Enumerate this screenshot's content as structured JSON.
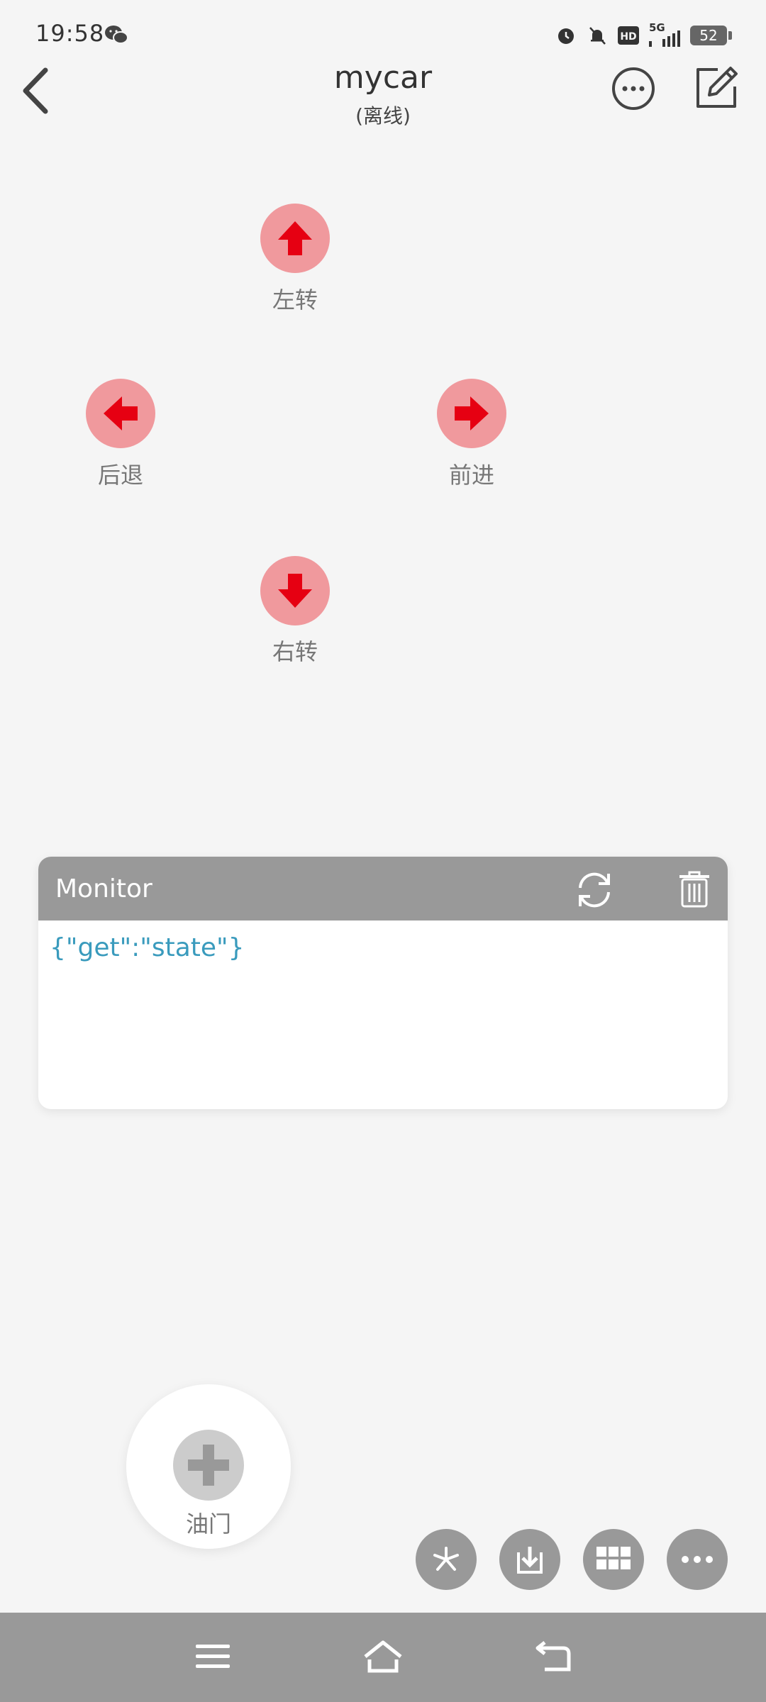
{
  "status_bar": {
    "time": "19:58",
    "network": "5G",
    "battery": "52",
    "icons": [
      "wechat-icon",
      "alarm-icon",
      "mute-bell-icon",
      "hd-icon",
      "signal-icon",
      "battery-icon"
    ]
  },
  "header": {
    "title": "mycar",
    "subtitle": "(离线)"
  },
  "controls": {
    "up_label": "左转",
    "left_label": "后退",
    "right_label": "前进",
    "down_label": "右转"
  },
  "monitor": {
    "title": "Monitor",
    "log": "{\"get\":\"state\"}"
  },
  "throttle": {
    "label": "油门"
  },
  "colors": {
    "background": "#f5f5f5",
    "button_fill": "#f0999d",
    "arrow_red": "#e60012",
    "monitor_header": "#999999",
    "monitor_text": "#3a9bbd",
    "nav_bar": "#999999"
  }
}
